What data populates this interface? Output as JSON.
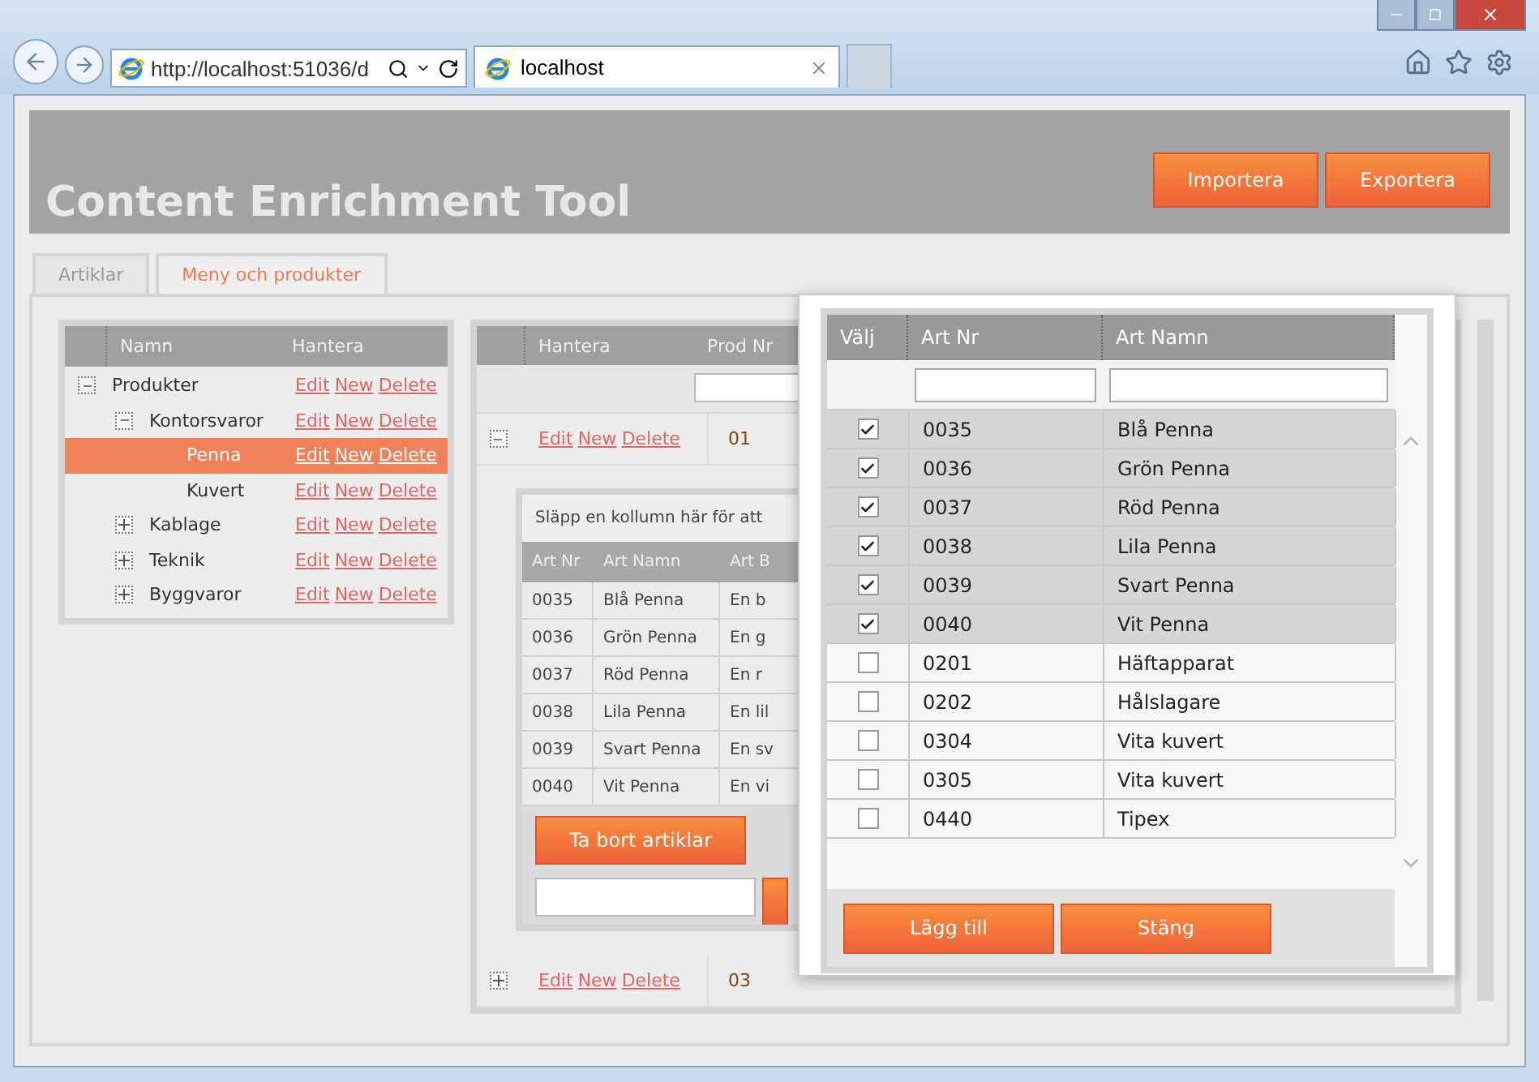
{
  "browser": {
    "address": "http://localhost:51036/d",
    "tab": "localhost"
  },
  "header": {
    "title": "Content Enrichment Tool",
    "buttons": [
      "Importera",
      "Exportera"
    ]
  },
  "tabs": [
    {
      "label": "Artiklar",
      "selected": false
    },
    {
      "label": "Meny och produkter",
      "selected": true
    }
  ],
  "tree": {
    "columns": [
      "Namn",
      "Hantera"
    ],
    "items": [
      {
        "name": "Produkter",
        "expanded": true,
        "selected": false,
        "actions": [
          "Edit",
          "New",
          "Delete"
        ],
        "children": [
          {
            "name": "Kontorsvaror",
            "expanded": true,
            "selected": false,
            "actions": [
              "Edit",
              "New",
              "Delete"
            ],
            "children": [
              {
                "name": "Penna",
                "selected": true,
                "actions": [
                  "Edit",
                  "New",
                  "Delete"
                ]
              },
              {
                "name": "Kuvert",
                "selected": false,
                "actions": [
                  "Edit",
                  "New",
                  "Delete"
                ]
              }
            ]
          },
          {
            "name": "Kablage",
            "expanded": false,
            "selected": false,
            "actions": [
              "Edit",
              "New",
              "Delete"
            ]
          },
          {
            "name": "Teknik",
            "expanded": false,
            "selected": false,
            "actions": [
              "Edit",
              "New",
              "Delete"
            ]
          },
          {
            "name": "Byggvaror",
            "expanded": false,
            "selected": false,
            "actions": [
              "Edit",
              "New",
              "Delete"
            ]
          }
        ]
      }
    ]
  },
  "grid": {
    "columns": [
      "Hantera",
      "Prod Nr"
    ],
    "rows": [
      {
        "expanded": true,
        "actions": [
          "Edit",
          "New",
          "Delete"
        ],
        "prod_nr": "01"
      },
      {
        "expanded": false,
        "actions": [
          "Edit",
          "New",
          "Delete"
        ],
        "prod_nr": "03"
      }
    ],
    "detail": {
      "group_hint": "Släpp en kollumn här för att",
      "columns": [
        "Art Nr",
        "Art Namn",
        "Art B"
      ],
      "rows": [
        [
          "0035",
          "Blå Penna",
          "En b"
        ],
        [
          "0036",
          "Grön Penna",
          "En g"
        ],
        [
          "0037",
          "Röd Penna",
          "En r"
        ],
        [
          "0038",
          "Lila Penna",
          "En lil"
        ],
        [
          "0039",
          "Svart Penna",
          "En sv"
        ],
        [
          "0040",
          "Vit Penna",
          "En vi"
        ]
      ],
      "button": "Ta bort artiklar"
    }
  },
  "modal": {
    "columns": [
      "Välj",
      "Art Nr",
      "Art Namn"
    ],
    "rows": [
      {
        "checked": true,
        "art_nr": "0035",
        "name": "Blå Penna"
      },
      {
        "checked": true,
        "art_nr": "0036",
        "name": "Grön Penna"
      },
      {
        "checked": true,
        "art_nr": "0037",
        "name": "Röd Penna"
      },
      {
        "checked": true,
        "art_nr": "0038",
        "name": "Lila Penna"
      },
      {
        "checked": true,
        "art_nr": "0039",
        "name": "Svart Penna"
      },
      {
        "checked": true,
        "art_nr": "0040",
        "name": "Vit Penna"
      },
      {
        "checked": false,
        "art_nr": "0201",
        "name": "Häftapparat"
      },
      {
        "checked": false,
        "art_nr": "0202",
        "name": "Hålslagare"
      },
      {
        "checked": false,
        "art_nr": "0304",
        "name": "Vita kuvert"
      },
      {
        "checked": false,
        "art_nr": "0305",
        "name": "Vita kuvert"
      },
      {
        "checked": false,
        "art_nr": "0440",
        "name": "Tipex"
      }
    ],
    "buttons": [
      "Lägg till",
      "Stäng"
    ]
  }
}
